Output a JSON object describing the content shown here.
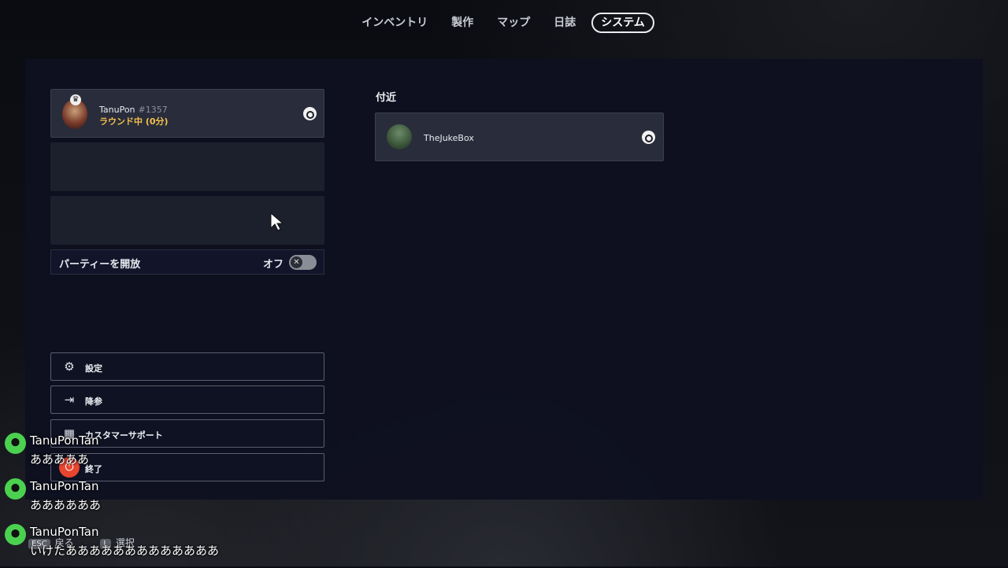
{
  "tabs": [
    {
      "label": "インベントリ",
      "active": false
    },
    {
      "label": "製作",
      "active": false
    },
    {
      "label": "マップ",
      "active": false
    },
    {
      "label": "日誌",
      "active": false
    },
    {
      "label": "システム",
      "active": true
    }
  ],
  "profile": {
    "name": "TanuPon",
    "tag": "#1357",
    "status": "ラウンド中 (0分)",
    "icon": "steam-icon"
  },
  "party": {
    "label": "パーティーを開放",
    "state": "オフ"
  },
  "menu": [
    {
      "label": "設定",
      "icon": "gear-icon"
    },
    {
      "label": "降参",
      "icon": "exit-door-icon"
    },
    {
      "label": "カスタマーサポート",
      "icon": "support-icon"
    },
    {
      "label": "終了",
      "icon": "power-icon"
    }
  ],
  "nearby": {
    "title": "付近",
    "player": {
      "name": "TheJukeBox",
      "icon": "steam-icon"
    }
  },
  "chat": [
    {
      "name": "TanuPonTan",
      "text": "あああああ"
    },
    {
      "name": "TanuPonTan",
      "text": "ああああああ"
    },
    {
      "name": "TanuPonTan",
      "text": "いけたあああああああああああああ"
    }
  ],
  "hints": {
    "back_key": "ESC",
    "back_label": "戻る",
    "select_key": "L",
    "select_label": "選択"
  }
}
